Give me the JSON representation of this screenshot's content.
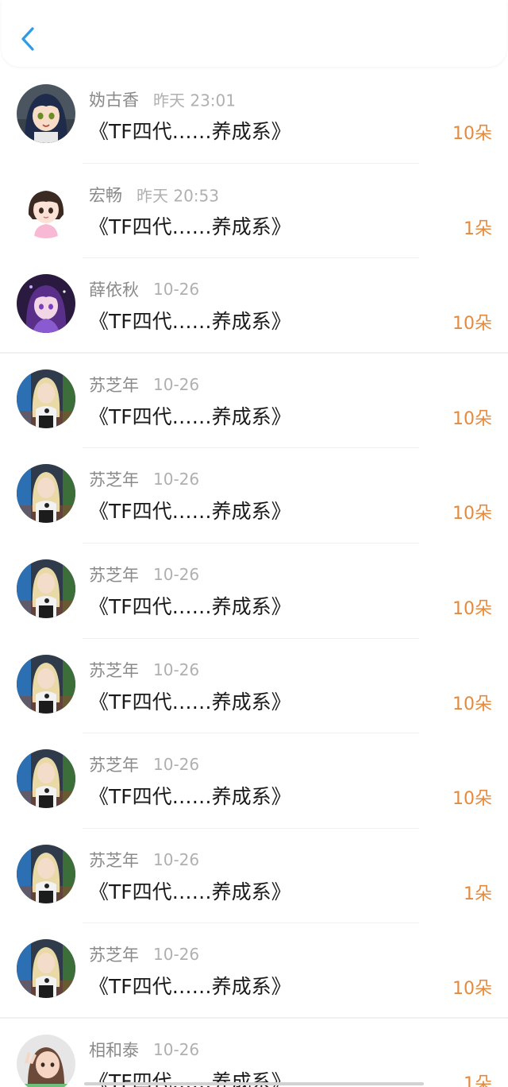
{
  "header": {
    "back_icon": "chevron-left-icon",
    "accent_color": "#2e9be6"
  },
  "colors": {
    "flower_count": "#e58a3c",
    "name": "#8a8a8a",
    "time": "#b0b0b0"
  },
  "records": [
    {
      "name": "妫古香",
      "time": "昨天 23:01",
      "book": "《TF四代……养成系》",
      "flowers": "10朵",
      "avatar": "anime-girl-blue-hair"
    },
    {
      "name": "宏畅",
      "time": "昨天 20:53",
      "book": "《TF四代……养成系》",
      "flowers": "1朵",
      "avatar": "cartoon-girl-pink"
    },
    {
      "name": "薛依秋",
      "time": "10-26",
      "book": "《TF四代……养成系》",
      "flowers": "10朵",
      "avatar": "anime-girl-purple"
    },
    {
      "name": "苏芝年",
      "time": "10-26",
      "book": "《TF四代……养成系》",
      "flowers": "10朵",
      "avatar": "blonde-woman-photo"
    },
    {
      "name": "苏芝年",
      "time": "10-26",
      "book": "《TF四代……养成系》",
      "flowers": "10朵",
      "avatar": "blonde-woman-photo"
    },
    {
      "name": "苏芝年",
      "time": "10-26",
      "book": "《TF四代……养成系》",
      "flowers": "10朵",
      "avatar": "blonde-woman-photo"
    },
    {
      "name": "苏芝年",
      "time": "10-26",
      "book": "《TF四代……养成系》",
      "flowers": "10朵",
      "avatar": "blonde-woman-photo"
    },
    {
      "name": "苏芝年",
      "time": "10-26",
      "book": "《TF四代……养成系》",
      "flowers": "10朵",
      "avatar": "blonde-woman-photo"
    },
    {
      "name": "苏芝年",
      "time": "10-26",
      "book": "《TF四代……养成系》",
      "flowers": "1朵",
      "avatar": "blonde-woman-photo"
    },
    {
      "name": "苏芝年",
      "time": "10-26",
      "book": "《TF四代……养成系》",
      "flowers": "10朵",
      "avatar": "blonde-woman-photo"
    },
    {
      "name": "相和泰",
      "time": "10-26",
      "book": "《TF四代……养成系》",
      "flowers": "1朵",
      "avatar": "girl-peace-sign-photo"
    }
  ]
}
